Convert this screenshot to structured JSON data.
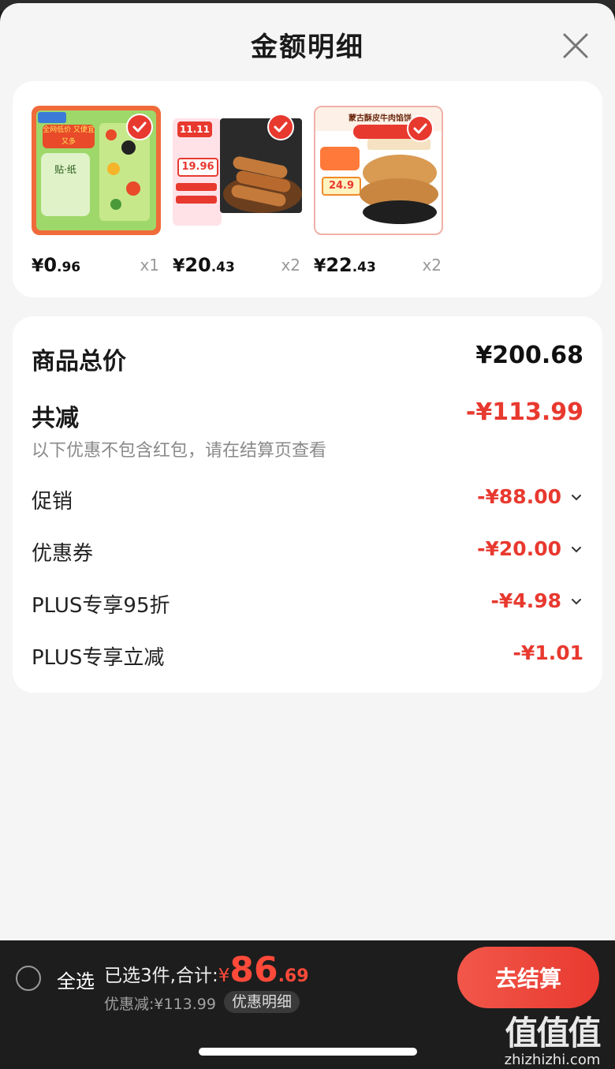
{
  "header": {
    "title": "金额明细"
  },
  "products": [
    {
      "price_int": "0",
      "price_dec": ".96",
      "qty": "x1",
      "thumb_title": "全网低价 又便宜又多",
      "thumb_label": "贴·纸"
    },
    {
      "price_int": "20",
      "price_dec": ".43",
      "qty": "x2",
      "thumb_title": "11.11",
      "thumb_label": "19.96"
    },
    {
      "price_int": "22",
      "price_dec": ".43",
      "qty": "x2",
      "thumb_title": "蒙古酥皮牛肉馅饼",
      "thumb_label": "24.9"
    }
  ],
  "currency": "¥",
  "detail": {
    "total_label": "商品总价",
    "total_value": "¥200.68",
    "discount_label": "共减",
    "discount_value": "-¥113.99",
    "note": "以下优惠不包含红包，请在结算页查看",
    "items": [
      {
        "label": "促销",
        "value": "-¥88.00",
        "expandable": true
      },
      {
        "label": "优惠券",
        "value": "-¥20.00",
        "expandable": true
      },
      {
        "label": "PLUS专享95折",
        "value": "-¥4.98",
        "expandable": true
      },
      {
        "label": "PLUS专享立减",
        "value": "-¥1.01",
        "expandable": false
      }
    ]
  },
  "bottom": {
    "select_all": "全选",
    "selected_text": "已选3件,合计:",
    "total_int": "86",
    "total_dec": ".69",
    "discount_text": "优惠减:¥113.99",
    "detail_pill": "优惠明细",
    "checkout": "去结算"
  },
  "watermark": {
    "main": "值值值",
    "sub": "zhizhizhi.com"
  },
  "colors": {
    "accent": "#e8392f",
    "background": "#f5f5f5",
    "bar": "#1d1d1d"
  }
}
